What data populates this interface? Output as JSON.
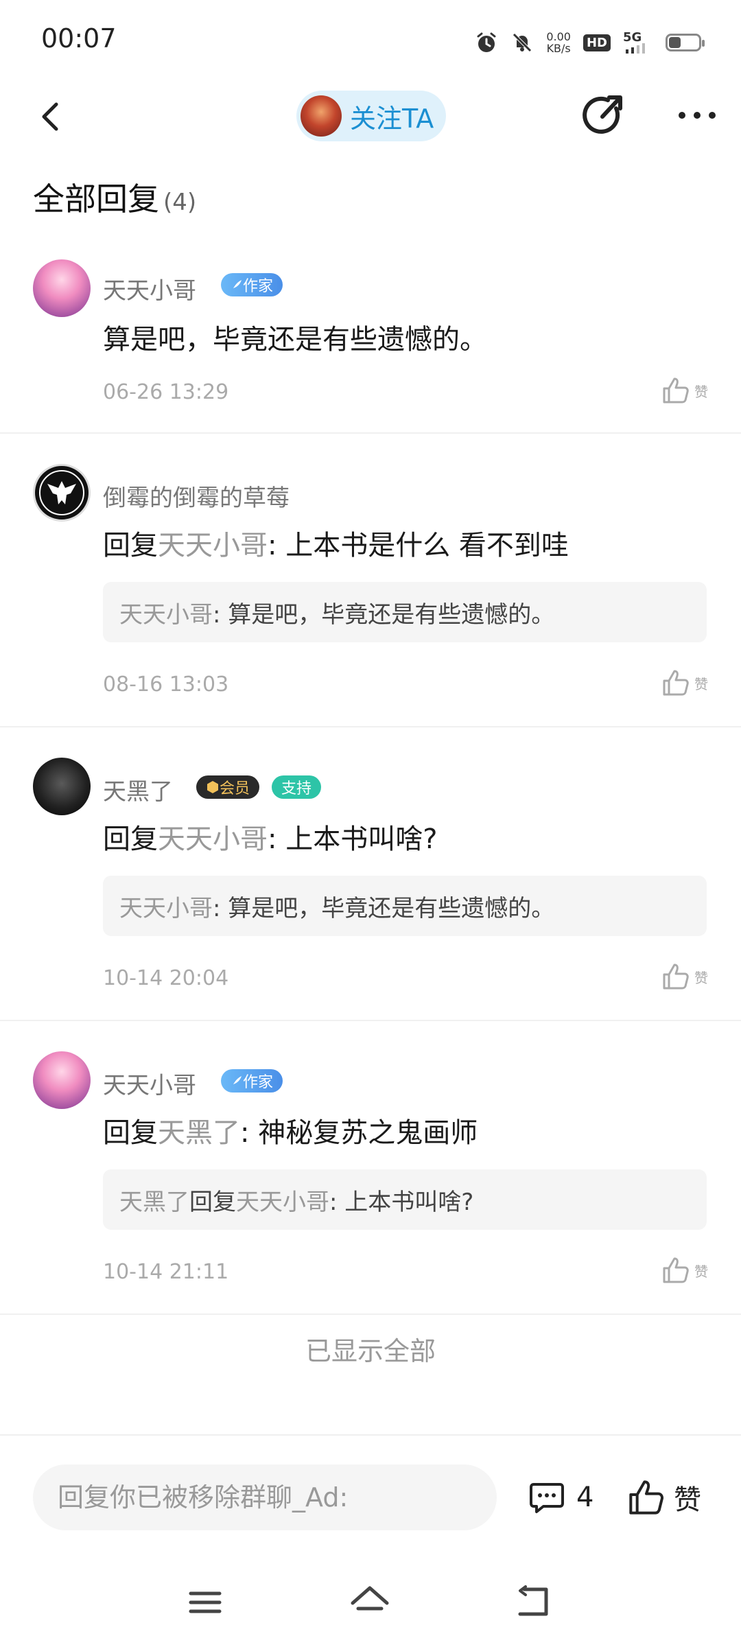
{
  "status_bar": {
    "time": "00:07",
    "net_speed_value": "0.00",
    "net_speed_unit": "KB/s",
    "hd_label": "HD",
    "network_label": "5G",
    "battery_level_percent": 40,
    "icons": [
      "alarm-icon",
      "mute-bell-icon",
      "hd-icon",
      "5g-signal-icon",
      "battery-icon"
    ]
  },
  "header": {
    "follow_label": "关注TA",
    "icons": [
      "back-icon",
      "share-icon",
      "more-icon"
    ]
  },
  "section": {
    "title": "全部回复",
    "count": "(4)"
  },
  "comments": [
    {
      "username": "天天小哥",
      "badges": [
        "作家"
      ],
      "text_prefix": "",
      "mention": "",
      "text": "算是吧，毕竟还是有些遗憾的。",
      "quote": null,
      "timestamp": "06-26 13:29",
      "like_label": "赞"
    },
    {
      "username": "倒霉的倒霉的草莓",
      "badges": [],
      "text_prefix": "回复",
      "mention": "天天小哥",
      "text": ": 上本书是什么 看不到哇",
      "quote": {
        "author": "天天小哥",
        "reply_word": "",
        "reply_target": "",
        "text": ": 算是吧，毕竟还是有些遗憾的。"
      },
      "timestamp": "08-16 13:03",
      "like_label": "赞"
    },
    {
      "username": "天黑了",
      "badges": [
        "会员",
        "支持"
      ],
      "text_prefix": "回复",
      "mention": "天天小哥",
      "text": ": 上本书叫啥?",
      "quote": {
        "author": "天天小哥",
        "reply_word": "",
        "reply_target": "",
        "text": ": 算是吧，毕竟还是有些遗憾的。"
      },
      "timestamp": "10-14 20:04",
      "like_label": "赞"
    },
    {
      "username": "天天小哥",
      "badges": [
        "作家"
      ],
      "text_prefix": "回复",
      "mention": "天黑了",
      "text": ": 神秘复苏之鬼画师",
      "quote": {
        "author": "天黑了",
        "reply_word": "回复",
        "reply_target": "天天小哥",
        "text": ": 上本书叫啥?"
      },
      "timestamp": "10-14 21:11",
      "like_label": "赞"
    }
  ],
  "footer_note": "已显示全部",
  "bottom_bar": {
    "reply_placeholder": "回复你已被移除群聊_Ad:",
    "comment_count": "4",
    "like_label": "赞"
  },
  "nav_keys": [
    "menu-icon",
    "home-icon",
    "back-nav-icon"
  ]
}
